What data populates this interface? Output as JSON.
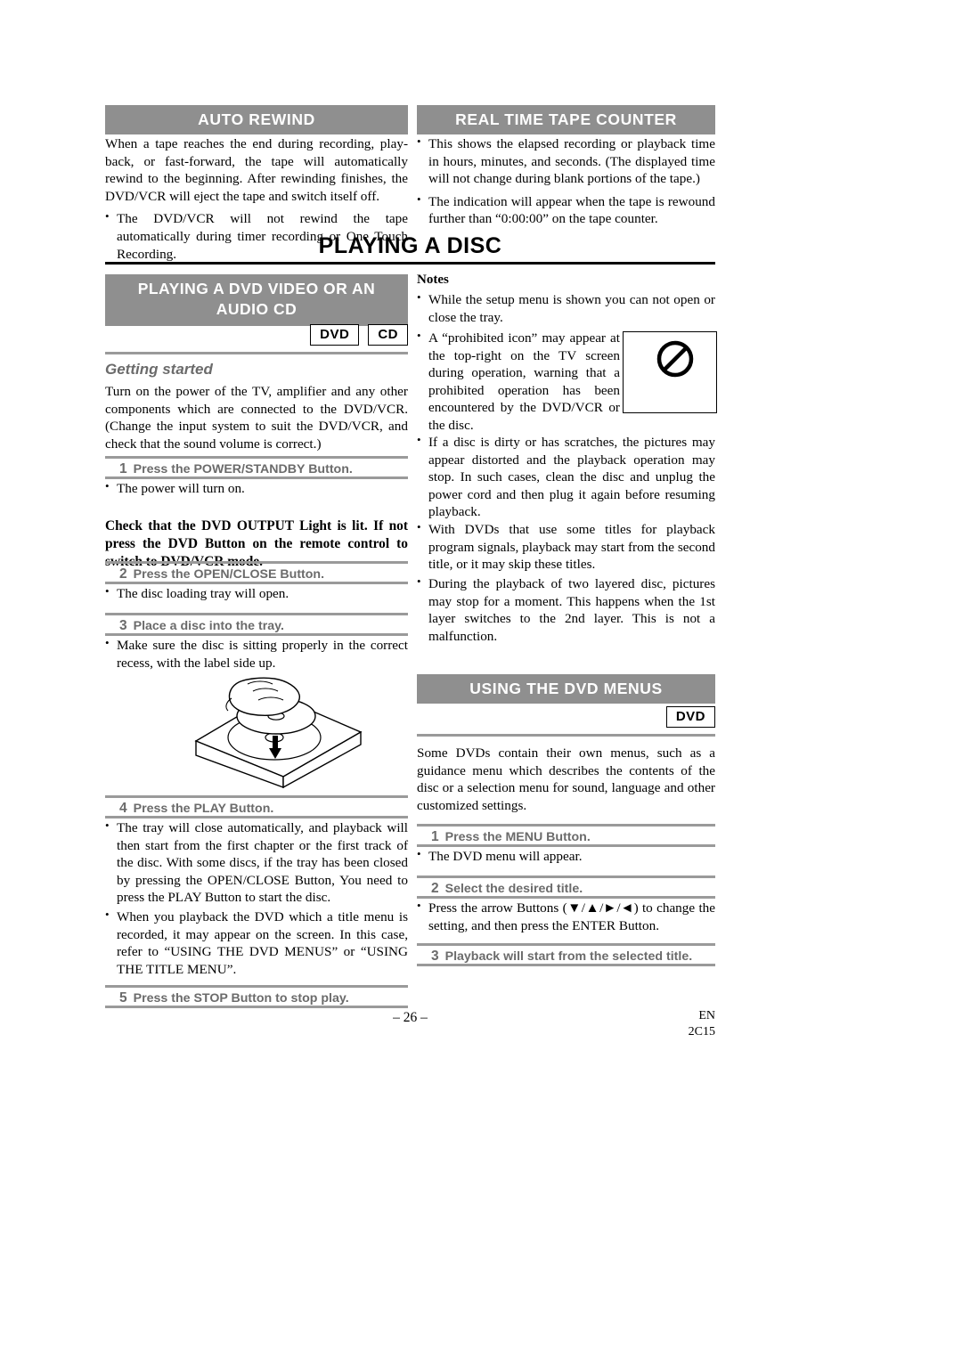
{
  "sections": {
    "auto_rewind": {
      "heading": "AUTO REWIND",
      "para1": "When a tape reaches the end during recording, play-back, or fast-forward, the tape will automatically rewind to the beginning. After rewinding finishes, the DVD/VCR will eject the tape and switch itself off.",
      "bullet1": "The DVD/VCR will not rewind the tape automatically during timer recording or One Touch Recording."
    },
    "real_time_tape_counter": {
      "heading": "REAL TIME TAPE COUNTER",
      "bullet1": "This shows the elapsed recording or playback time in hours, minutes, and seconds. (The displayed time will not change during blank portions of the tape.)",
      "bullet2": "The indication will appear when the tape is rewound further than “0:00:00” on the tape counter."
    },
    "playing_a_disc": {
      "title": "PLAYING A DISC"
    },
    "playing_dvd_video": {
      "heading_line1": "PLAYING A DVD VIDEO OR AN",
      "heading_line2": "AUDIO CD",
      "badges": [
        "DVD",
        "CD"
      ],
      "getting_started_label": "Getting started",
      "getting_started_text": "Turn on the power of the TV, amplifier and any other components which are connected to the DVD/VCR. (Change the input system to suit the DVD/VCR, and check that the sound volume is correct.)",
      "steps": [
        {
          "num": "1",
          "text": "Press the POWER/STANDBY Button."
        },
        {
          "num": "2",
          "text": "Press the OPEN/CLOSE Button."
        },
        {
          "num": "3",
          "text": "Place a disc into the tray."
        },
        {
          "num": "4",
          "text": "Press the PLAY Button."
        },
        {
          "num": "5",
          "text": "Press the STOP Button to stop play."
        }
      ],
      "after_step1": "The power will turn on.",
      "bold_note": "Check that the DVD OUTPUT Light is lit.  If not press the DVD Button on the remote control to switch to DVD/VCR mode.",
      "after_step2": "The disc loading tray will open.",
      "after_step3": "Make sure the disc is sitting properly in the correct recess, with the label side up.",
      "after_step4_a": "The tray will close automatically, and playback will then start from the first chapter or the first track of the disc. With some discs, if the tray has been closed by pressing the OPEN/CLOSE Button, You need to press the PLAY Button to start the disc.",
      "after_step4_b": "When you playback the DVD which a title menu is recorded, it may appear on the screen. In this case, refer to “USING THE DVD MENUS” or “USING THE TITLE MENU”."
    },
    "notes": {
      "title": "Notes",
      "items": [
        "While the setup menu is shown you can not open or close the tray.",
        "A “prohibited icon” may appear at the top-right on the TV screen during operation, warning that a prohibited operation has been encountered by the DVD/VCR or the disc.",
        "If a disc is dirty or has scratches, the pictures may appear distorted and the playback operation may stop. In such cases, clean the disc and unplug the power cord and then plug it again before resuming playback.",
        "With DVDs that use some titles for playback program signals, playback may start from the second title, or it may skip these titles.",
        "During the playback of two layered disc, pictures may stop for a moment. This happens when the 1st layer switches to the 2nd layer. This is not a malfunction."
      ]
    },
    "using_dvd_menus": {
      "heading": "USING THE DVD MENUS",
      "badge": "DVD",
      "intro": "Some DVDs contain their own menus, such as a guidance menu which describes the contents of the disc or a selection menu for sound, language and other customized settings.",
      "steps": [
        {
          "num": "1",
          "text": "Press the MENU Button."
        },
        {
          "num": "2",
          "text": "Select the desired title."
        },
        {
          "num": "3",
          "text": "Playback will start from the selected title."
        }
      ],
      "after_step1": "The DVD menu will appear.",
      "after_step2": "Press the arrow Buttons (▼/▲/►/◄) to change the setting, and then press the ENTER Button."
    },
    "footer": {
      "page": "– 26 –",
      "lang": "EN",
      "code": "2C15"
    }
  }
}
